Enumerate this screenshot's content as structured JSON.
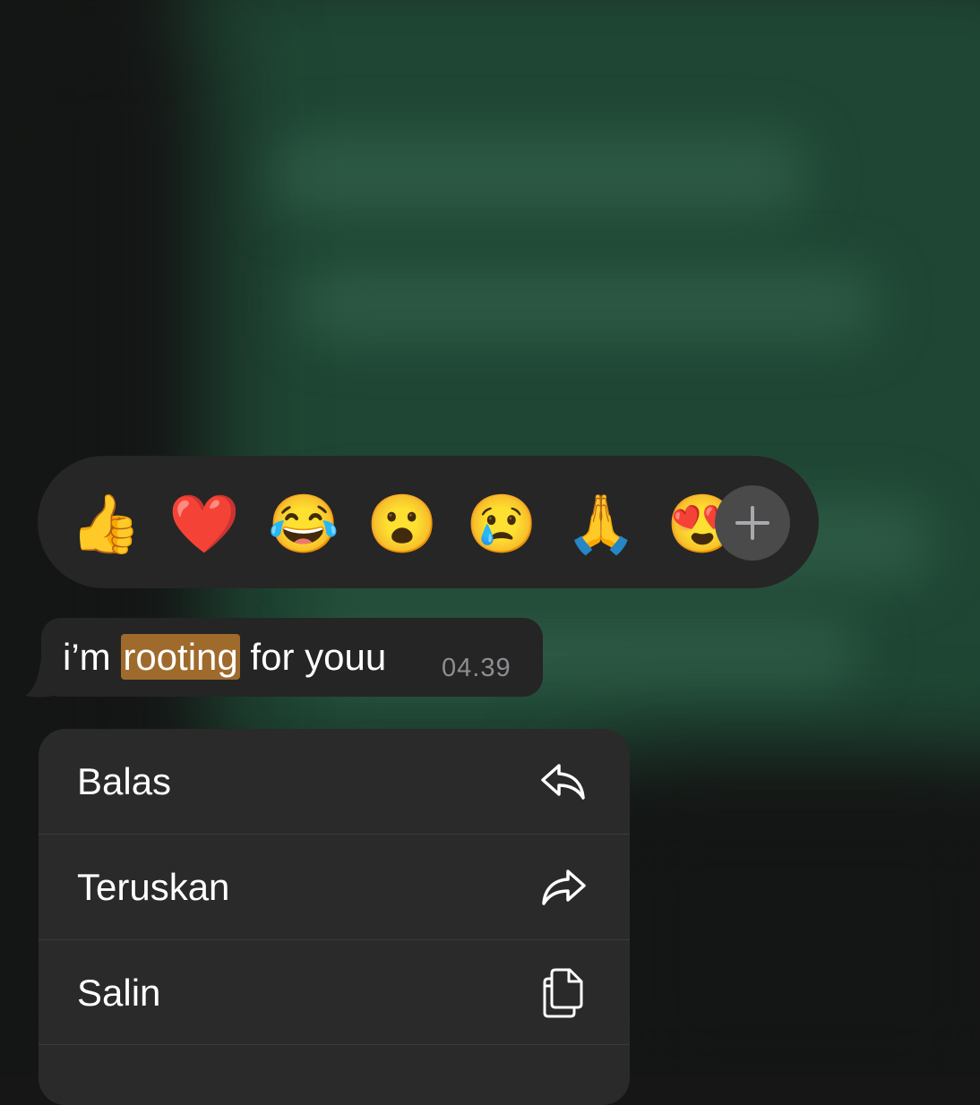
{
  "reactions": {
    "emojis": [
      {
        "name": "thumbs-up",
        "glyph": "👍"
      },
      {
        "name": "red-heart",
        "glyph": "❤️"
      },
      {
        "name": "face-with-tears-of-joy",
        "glyph": "😂"
      },
      {
        "name": "face-with-open-mouth",
        "glyph": "😮"
      },
      {
        "name": "crying-face",
        "glyph": "😢"
      },
      {
        "name": "folded-hands",
        "glyph": "🙏"
      },
      {
        "name": "smiling-face-with-heart-eyes",
        "glyph": "😍"
      }
    ],
    "more_icon": "plus-icon"
  },
  "message": {
    "text_before": "i’m ",
    "text_highlight": "rooting",
    "text_after": " for youu",
    "time": "04.39"
  },
  "menu": {
    "items": [
      {
        "label": "Balas",
        "icon": "reply-icon"
      },
      {
        "label": "Teruskan",
        "icon": "forward-icon"
      },
      {
        "label": "Salin",
        "icon": "copy-icon"
      }
    ]
  },
  "colors": {
    "highlight": "#9e6b2c",
    "chat_background": "#1f4634",
    "bubble": "#252525",
    "menu": "#2a2a2a"
  }
}
